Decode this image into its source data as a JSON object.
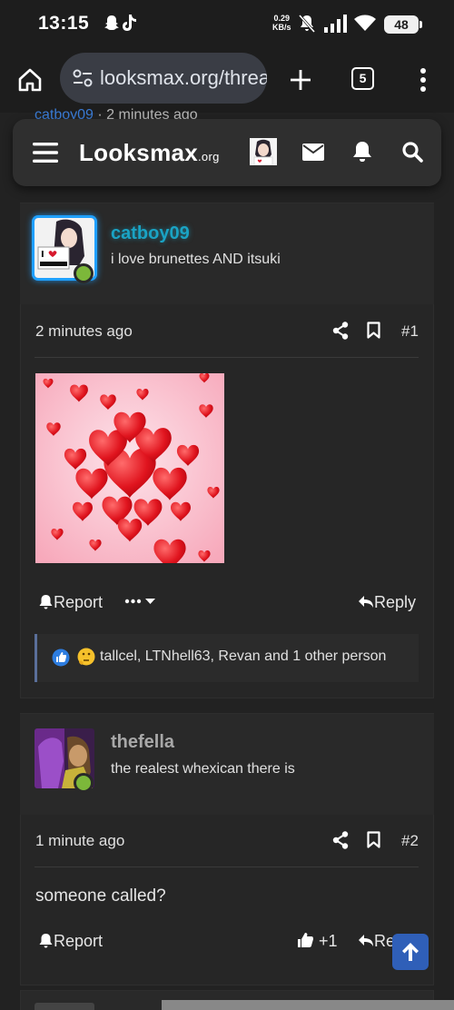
{
  "status_bar": {
    "time": "13:15",
    "net_speed": "0.29",
    "net_unit": "KB/s",
    "battery": "48"
  },
  "browser": {
    "url": "looksmax.org/threads",
    "tab_count": "5"
  },
  "ghost_line": {
    "user": "catboy09",
    "sep": " · ",
    "time": "2 minutes ago"
  },
  "header": {
    "logo_main": "Looksmax",
    "logo_suffix": ".org"
  },
  "posts": [
    {
      "username": "catboy09",
      "user_title": "i love brunettes AND itsuki",
      "time": "2 minutes ago",
      "number": "#1",
      "report_label": "Report",
      "reply_label": "Reply",
      "reactions_text": "tallcel, LTNhell63, Revan and 1 other person",
      "username_color": "#1aa3c4"
    },
    {
      "username": "thefella",
      "user_title": "the realest whexican there is",
      "time": "1 minute ago",
      "number": "#2",
      "body": "someone called?",
      "report_label": "Report",
      "like_count": "+1",
      "reply_label": "Reply",
      "username_color": "#a8a8a8"
    }
  ],
  "colors": {
    "accent": "#2f5fb8",
    "online": "#7cb83a"
  },
  "icons": [
    "home-icon",
    "site-settings-icon",
    "plus-icon",
    "menu-icon",
    "mail-icon",
    "bell-icon",
    "search-icon",
    "share-icon",
    "bookmark-icon",
    "report-bell-icon",
    "reply-icon",
    "thumbs-up-icon",
    "arrow-up-icon"
  ]
}
